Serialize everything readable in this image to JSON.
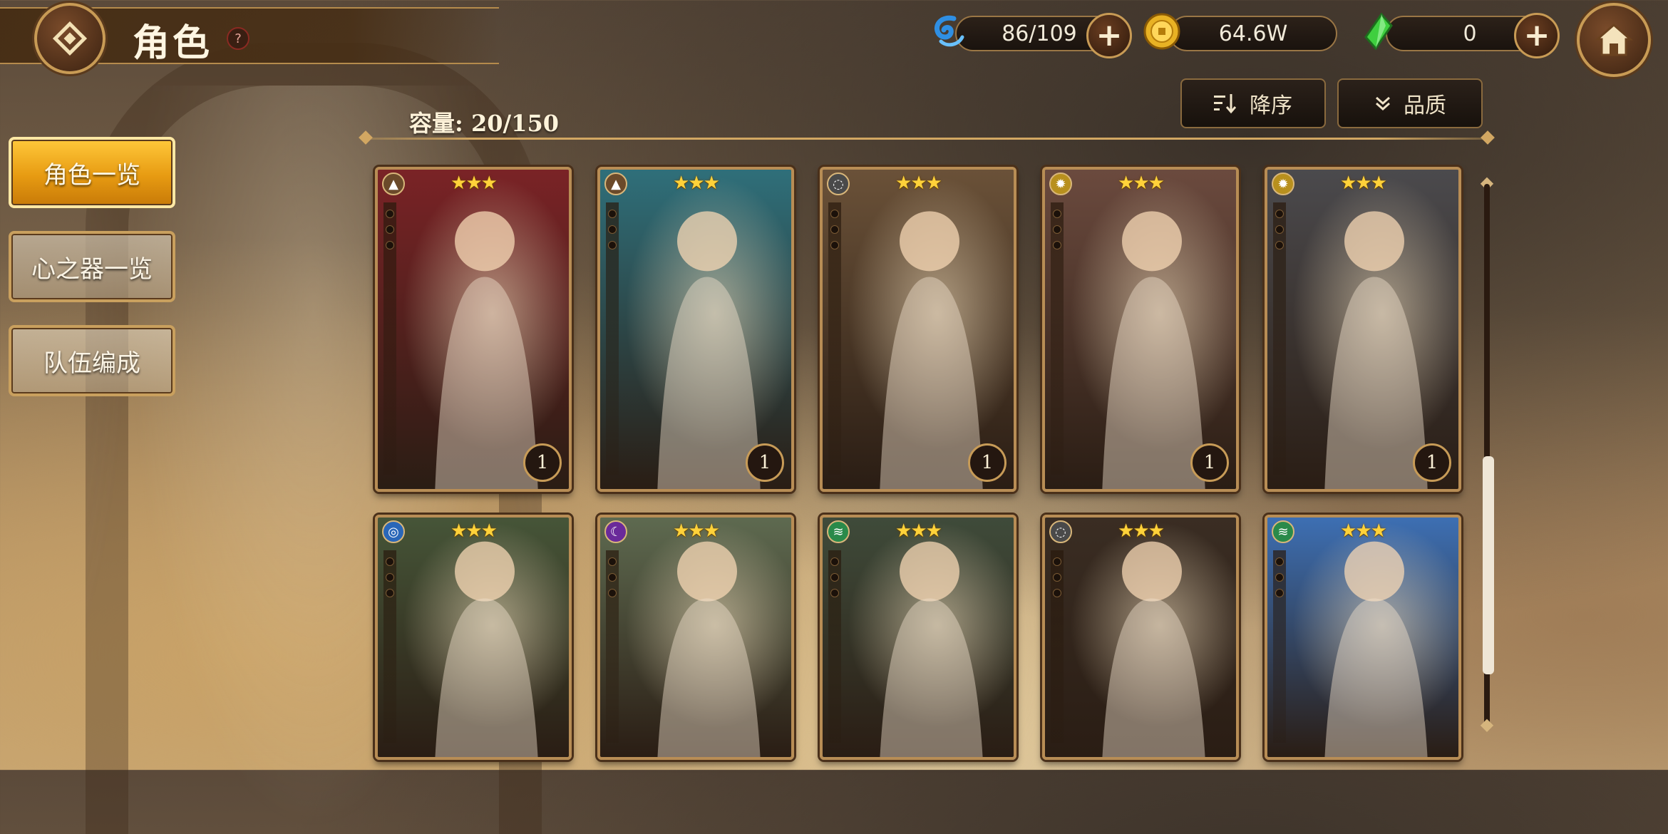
{
  "header": {
    "title": "角色",
    "help": "?"
  },
  "resources": [
    {
      "name": "stamina",
      "icon": "blue-swirl-icon",
      "value": "86/109"
    },
    {
      "name": "gold",
      "icon": "gold-coin-icon",
      "value": "64.6W"
    },
    {
      "name": "gem",
      "icon": "green-crystal-icon",
      "value": "0"
    }
  ],
  "sidebar": {
    "items": [
      {
        "label": "角色一览",
        "active": true
      },
      {
        "label": "心之器一览",
        "active": false
      },
      {
        "label": "队伍编成",
        "active": false
      }
    ]
  },
  "list": {
    "capacity": "容量: 20/150",
    "sort_order_label": "降序",
    "sort_key_label": "品质"
  },
  "cards": [
    {
      "stars": "★★★",
      "level": "1",
      "element": "earth",
      "palette": "#7a2326"
    },
    {
      "stars": "★★★",
      "level": "1",
      "element": "earth",
      "palette": "#2f6f7a"
    },
    {
      "stars": "★★★",
      "level": "1",
      "element": "neutral",
      "palette": "#6a5138"
    },
    {
      "stars": "★★★",
      "level": "1",
      "element": "light",
      "palette": "#6b4a3e"
    },
    {
      "stars": "★★★",
      "level": "1",
      "element": "light",
      "palette": "#4b4a4d"
    },
    {
      "stars": "★★★",
      "level": "",
      "element": "water",
      "palette": "#465538"
    },
    {
      "stars": "★★★",
      "level": "",
      "element": "dark",
      "palette": "#5e6a50"
    },
    {
      "stars": "★★★",
      "level": "",
      "element": "wind",
      "palette": "#3f4b3a"
    },
    {
      "stars": "★★★",
      "level": "",
      "element": "neutral",
      "palette": "#3a2d23"
    },
    {
      "stars": "★★★",
      "level": "",
      "element": "wind",
      "palette": "#3d6fb3"
    }
  ],
  "colors": {
    "accent_gold": "#c89b55",
    "active_tab": "#f0a818",
    "star": "#ffd23a"
  }
}
